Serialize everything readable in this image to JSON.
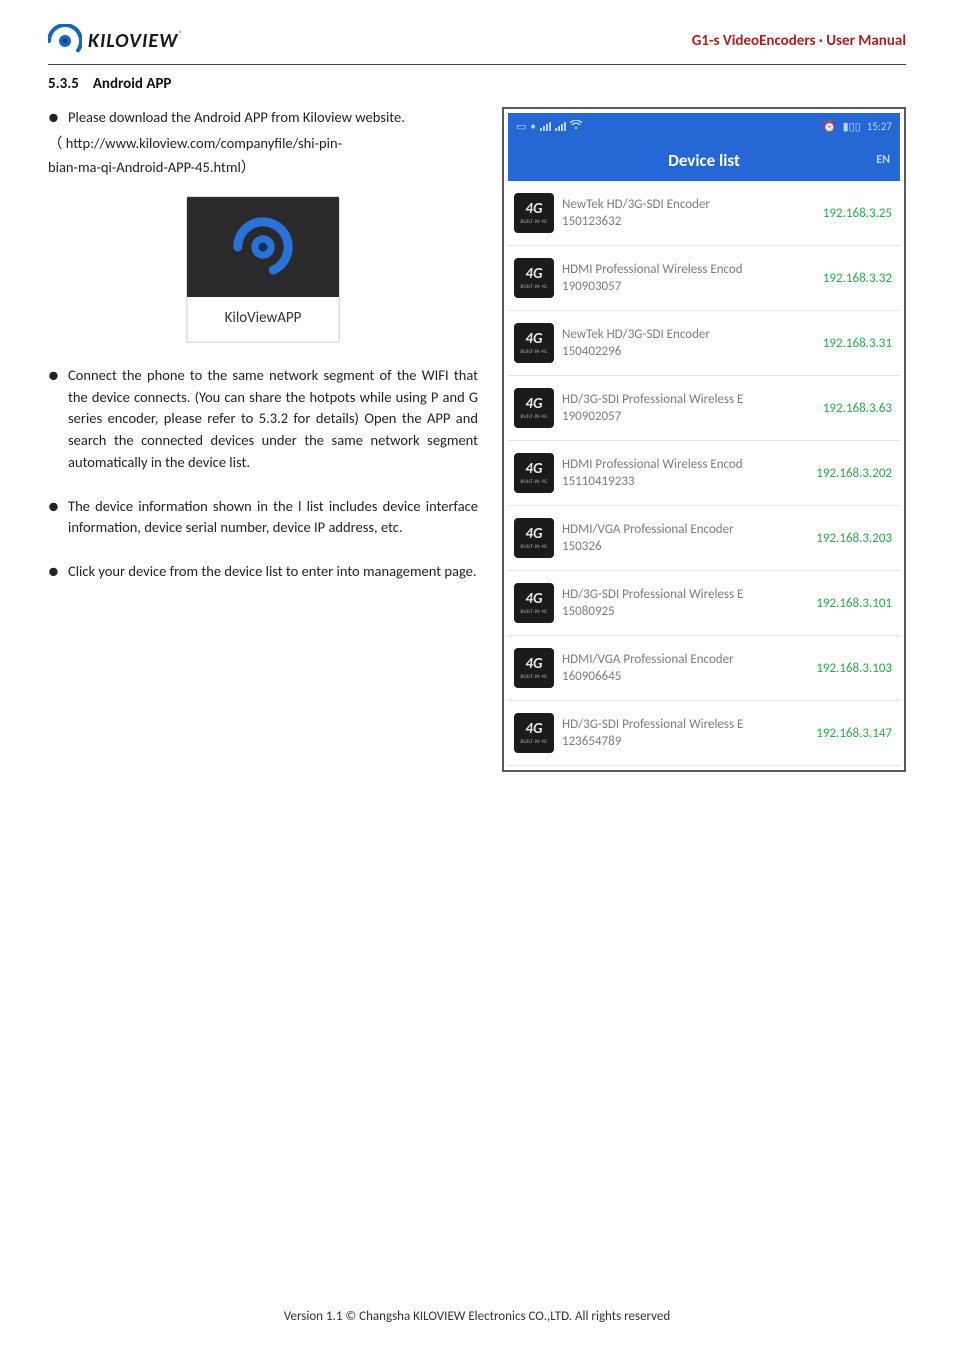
{
  "header": {
    "brand": "KILOVIEW",
    "brand_suffix": "®",
    "doc_title": "G1-s VideoEncoders · User Manual"
  },
  "section": {
    "number": "5.3.5",
    "title": "Android APP"
  },
  "left": {
    "b1": "Please download the Android APP from Kiloview website.",
    "url_line1": "（ http://www.kiloview.com/companyfile/shi-pin-",
    "url_line2": "bian-ma-qi-Android-APP-45.html）",
    "app_label": "KiloViewAPP",
    "b2": "Connect the phone to the same network segment of the WIFI that the device connects. (You can share the hotpots while using P and G series encoder, please refer to 5.3.2 for details) Open the APP and search the connected devices under the same network segment automatically in the device list.",
    "b3": "The device information shown in the l list includes device interface information, device serial number, device IP address, etc.",
    "b4": "Click your device from the device list to enter into management page."
  },
  "phone": {
    "status_time": "15:27",
    "title": "Device list",
    "lang": "EN",
    "icon_text": "4G",
    "icon_sub": "BUILT-IN 4G",
    "items": [
      {
        "name": "NewTek HD/3G-SDI Encoder",
        "serial": "150123632",
        "ip": "192.168.3.25"
      },
      {
        "name": "HDMI Professional Wireless Encod",
        "serial": "190903057",
        "ip": "192.168.3.32"
      },
      {
        "name": "NewTek HD/3G-SDI Encoder",
        "serial": "150402296",
        "ip": "192.168.3.31"
      },
      {
        "name": "HD/3G-SDI Professional Wireless E",
        "serial": "190902057",
        "ip": "192.168.3.63"
      },
      {
        "name": "HDMI Professional Wireless Encod",
        "serial": "15110419233",
        "ip": "192.168.3.202"
      },
      {
        "name": "HDMI/VGA Professional Encoder",
        "serial": "150326",
        "ip": "192.168.3.203"
      },
      {
        "name": "HD/3G-SDI Professional Wireless E",
        "serial": "15080925",
        "ip": "192.168.3.101"
      },
      {
        "name": "HDMI/VGA Professional Encoder",
        "serial": "160906645",
        "ip": "192.168.3.103"
      },
      {
        "name": "HD/3G-SDI Professional Wireless E",
        "serial": "123654789",
        "ip": "192.168.3.147"
      }
    ]
  },
  "footer": "Version 1.1 © Changsha KILOVIEW Electronics CO.,LTD. All rights reserved"
}
